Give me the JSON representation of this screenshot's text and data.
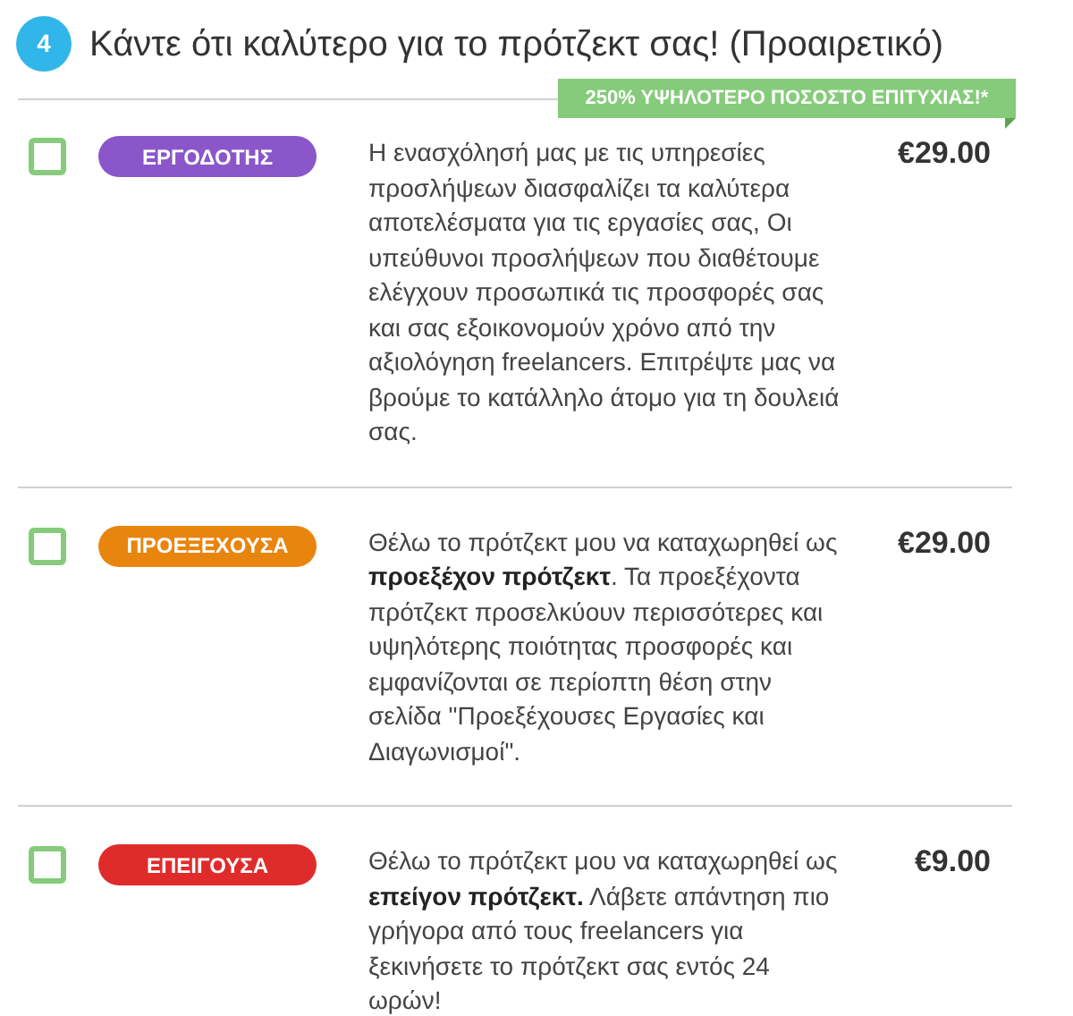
{
  "step": {
    "number": "4",
    "title": "Κάντε ότι καλύτερο για το πρότζεκτ σας! (Προαιρετικό)"
  },
  "ribbon": "250% ΥΨΗΛΟΤΕΡΟ ΠΟΣΟΣΤΟ ΕΠΙΤΥΧΙΑΣ!*",
  "upgrades": [
    {
      "checked": false,
      "badge": "ΕΡΓΟΔΟΤΗΣ",
      "color": "#8a56c9",
      "description": "Η ενασχόλησή μας με τις υπηρεσίες προσλήψεων διασφαλίζει τα καλύτερα αποτελέσματα για τις εργασίες σας, Οι υπεύθυνοι προσλήψεων που διαθέτουμε ελέγχουν προσωπικά τις προσφορές σας και σας εξοικονομούν χρόνο από την αξιολόγηση freelancers. Επιτρέψτε μας να βρούμε το κατάλληλο άτομο για τη δουλειά σας.",
      "price": "€29.00"
    },
    {
      "checked": false,
      "badge": "ΠΡΟΕΞΕΧΟΥΣΑ",
      "color": "#e8850e",
      "description": "Θέλω το πρότζεκτ μου να καταχωρηθεί ως **προεξέχον πρότζεκτ**. Τα προεξέχοντα πρότζεκτ προσελκύουν περισσότερες και υψηλότερης ποιότητας προσφορές και εμφανίζονται σε περίοπτη θέση στην σελίδα \"Προεξέχουσες Εργασίες και Διαγωνισμοί\".",
      "price": "€29.00"
    },
    {
      "checked": false,
      "badge": "ΕΠΕΙΓΟΥΣΑ",
      "color": "#e02b2b",
      "description": "Θέλω το πρότζεκτ μου να καταχωρηθεί ως **επείγον πρότζεκτ.** Λάβετε απάντηση πιο γρήγορα από τους freelancers για ξεκινήσετε το πρότζεκτ σας εντός 24 ωρών!",
      "price": "€9.00"
    }
  ]
}
